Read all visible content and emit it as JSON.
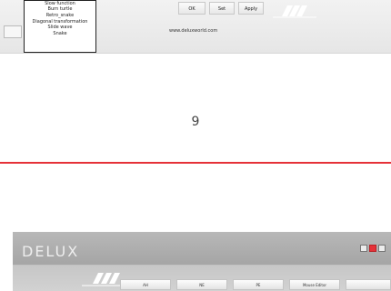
{
  "top_panel": {
    "dropdown_items": [
      "Slow function",
      "Burn turtle",
      "Retro_snake",
      "Diagonal transformation",
      "Slide wave",
      "Snake"
    ],
    "buttons": [
      "OK",
      "Set",
      "Apply"
    ],
    "url": "www.deluxworld.com"
  },
  "page_number": "9",
  "app_window": {
    "logo": "DELUX",
    "tabs": [
      "AH",
      "NE",
      "PE",
      "Mouse Editor"
    ]
  }
}
